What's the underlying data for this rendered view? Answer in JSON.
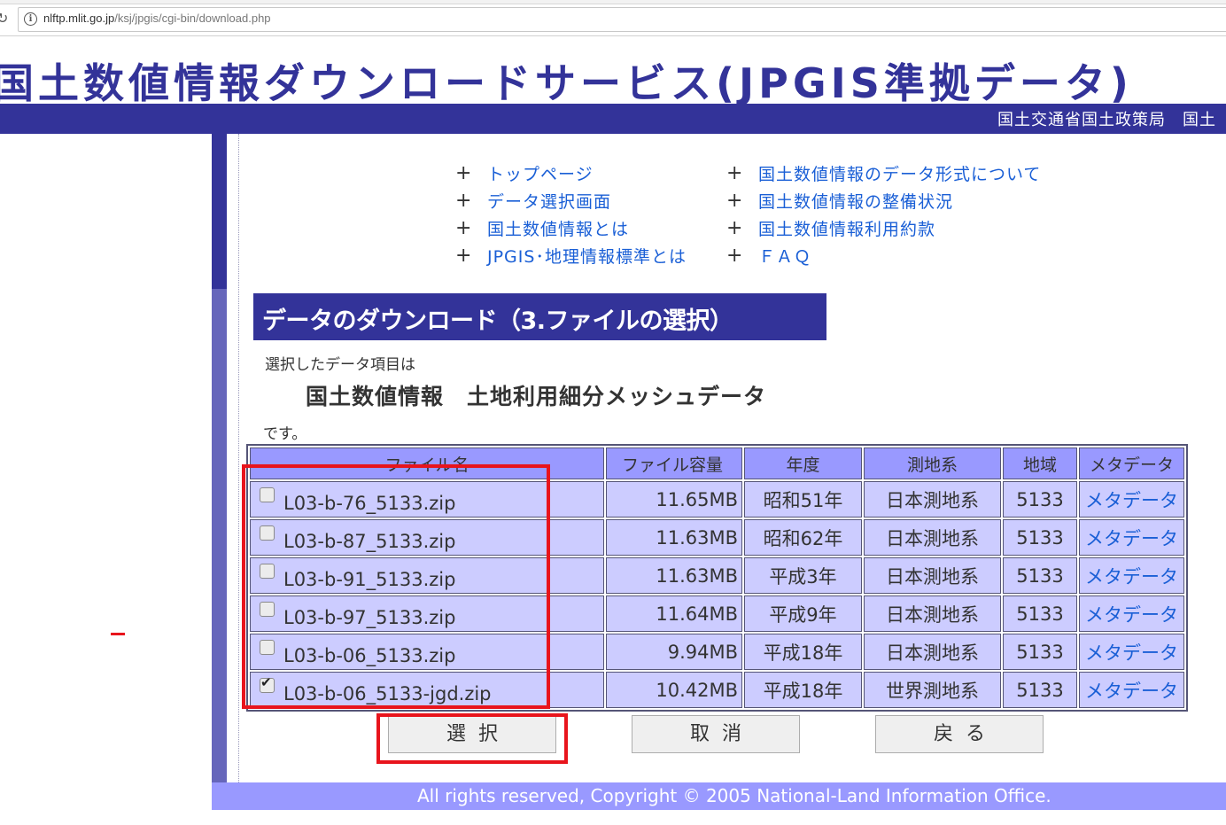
{
  "browser": {
    "url_host": "nlftp.mlit.go.jp",
    "url_path": "/ksj/jpgis/cgi-bin/download.php"
  },
  "header": {
    "title": "国土数値情報ダウンロードサービス(JPGIS準拠データ)",
    "ministry": "国土交通省国土政策局　国土"
  },
  "nav": {
    "left": [
      "トップページ",
      "データ選択画面",
      "国土数値情報とは",
      "JPGIS･地理情報標準とは"
    ],
    "right": [
      "国土数値情報のデータ形式について",
      "国土数値情報の整備状況",
      "国土数値情報利用約款",
      "ＦＡＱ"
    ],
    "plus": "+"
  },
  "section": {
    "title": "データのダウンロード（3.ファイルの選択）",
    "intro": "選択したデータ項目は",
    "dataset": "国土数値情報　土地利用細分メッシュデータ",
    "outro": "です。"
  },
  "table": {
    "headers": [
      "ファイル名",
      "ファイル容量",
      "年度",
      "測地系",
      "地域",
      "メタデータ"
    ],
    "rows": [
      {
        "name": "L03-b-76_5133.zip",
        "size": "11.65MB",
        "year": "昭和51年",
        "datum": "日本測地系",
        "area": "5133",
        "meta": "メタデータ",
        "checked": false
      },
      {
        "name": "L03-b-87_5133.zip",
        "size": "11.63MB",
        "year": "昭和62年",
        "datum": "日本測地系",
        "area": "5133",
        "meta": "メタデータ",
        "checked": false
      },
      {
        "name": "L03-b-91_5133.zip",
        "size": "11.63MB",
        "year": "平成3年",
        "datum": "日本測地系",
        "area": "5133",
        "meta": "メタデータ",
        "checked": false
      },
      {
        "name": "L03-b-97_5133.zip",
        "size": "11.64MB",
        "year": "平成9年",
        "datum": "日本測地系",
        "area": "5133",
        "meta": "メタデータ",
        "checked": false
      },
      {
        "name": "L03-b-06_5133.zip",
        "size": "9.94MB",
        "year": "平成18年",
        "datum": "日本測地系",
        "area": "5133",
        "meta": "メタデータ",
        "checked": false
      },
      {
        "name": "L03-b-06_5133-jgd.zip",
        "size": "10.42MB",
        "year": "平成18年",
        "datum": "世界測地系",
        "area": "5133",
        "meta": "メタデータ",
        "checked": true
      }
    ]
  },
  "buttons": {
    "select": "選択",
    "cancel": "取消",
    "back": "戻る"
  },
  "footer": {
    "copyright": "All rights reserved, Copyright © 2005 National-Land Information Office."
  },
  "colors": {
    "brand_navy": "#333399",
    "header_cell": "#9999ff",
    "body_cell": "#ccccff",
    "link": "#1a5fd6",
    "highlight": "#e8141c"
  }
}
